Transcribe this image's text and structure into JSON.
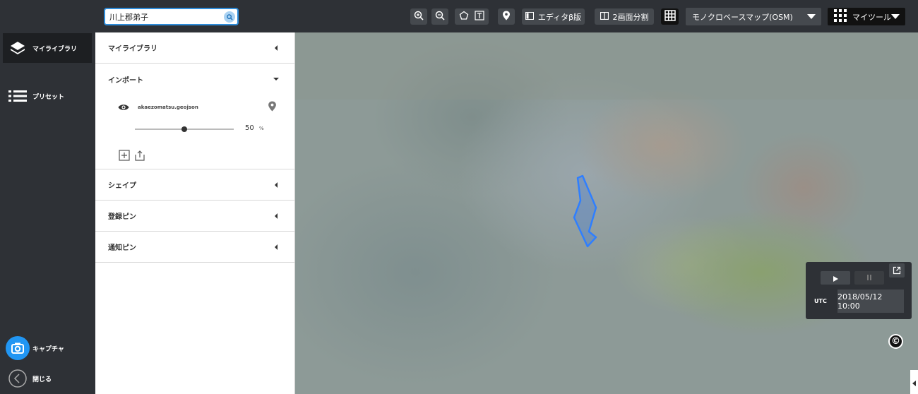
{
  "nav": {
    "items": [
      {
        "label": "マイライブラリ",
        "icon": "layers-icon"
      },
      {
        "label": "プリセット",
        "icon": "list-icon"
      }
    ],
    "capture_label": "キャプチャ",
    "close_label": "閉じる"
  },
  "search": {
    "value": "川上郡弟子"
  },
  "toolbar": {
    "editor_label": "エディタβ版",
    "split_label": "2画面分割",
    "basemap_label": "モノクロベースマップ(OSM)",
    "mytools_label": "マイツール"
  },
  "panel": {
    "sections": [
      "マイライブラリ",
      "インポート",
      "シェイプ",
      "登録ピン",
      "通知ピン"
    ],
    "layer": {
      "name": "akaezomatsu.geojson",
      "opacity": "50",
      "opacity_unit": "%",
      "opacity_fraction": 0.5
    }
  },
  "time": {
    "utc_label": "UTC",
    "datetime": "2018/05/12 10:00"
  },
  "map": {
    "polygon_color": "#2f7fff"
  },
  "copyright_symbol": "©"
}
